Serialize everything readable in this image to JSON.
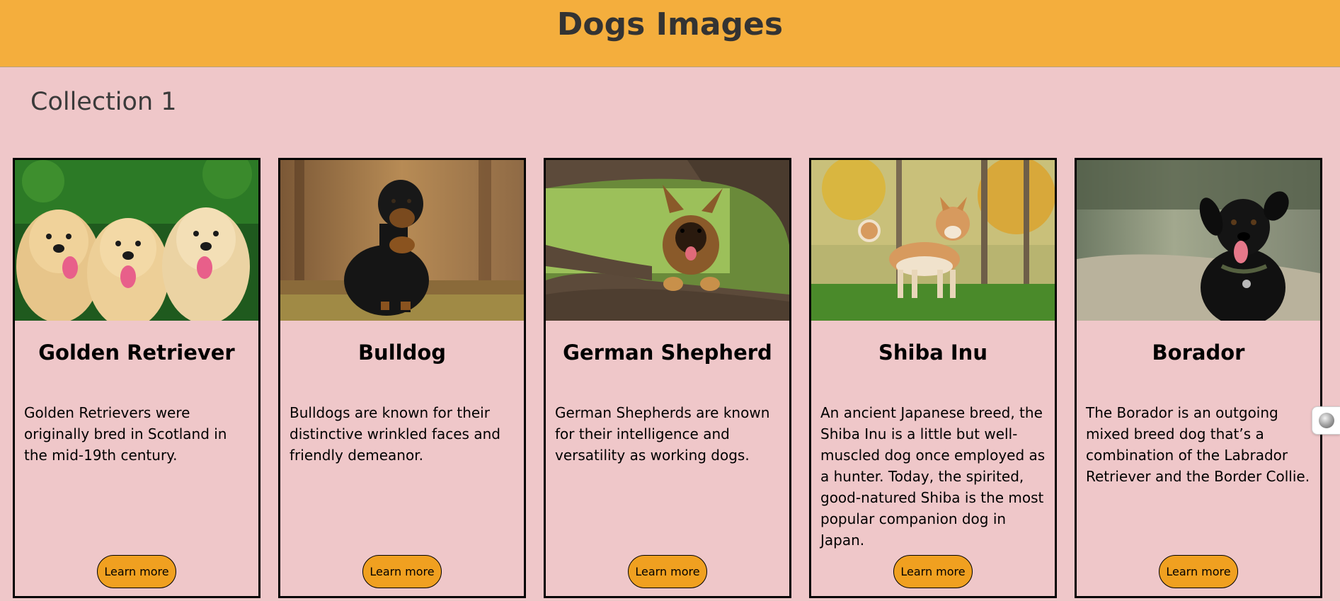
{
  "header": {
    "title": "Dogs Images"
  },
  "collection": {
    "title": "Collection 1"
  },
  "cards": [
    {
      "title": "Golden Retriever",
      "description": "Golden Retrievers were originally bred in Scotland in the mid-19th century.",
      "button_label": "Learn more",
      "image_icon": "golden-retriever-puppies-photo"
    },
    {
      "title": "Bulldog",
      "description": "Bulldogs are known for their distinctive wrinkled faces and friendly demeanor.",
      "button_label": "Learn more",
      "image_icon": "rottweiler-sitting-photo"
    },
    {
      "title": "German Shepherd",
      "description": "German Shepherds are known for their intelligence and versatility as working dogs.",
      "button_label": "Learn more",
      "image_icon": "german-shepherd-in-tree-photo"
    },
    {
      "title": "Shiba Inu",
      "description": "An ancient Japanese breed, the Shiba Inu is a little but well-muscled dog once employed as a hunter. Today, the spirited, good-natured Shiba is the most popular companion dog in Japan.",
      "button_label": "Learn more",
      "image_icon": "shiba-inu-standing-photo"
    },
    {
      "title": "Borador",
      "description": "The Borador is an outgoing mixed breed dog that’s a combination of the Labrador Retriever and the Border Collie.",
      "button_label": "Learn more",
      "image_icon": "black-borador-photo"
    }
  ],
  "colors": {
    "header_bg": "#f4ae3d",
    "page_bg": "#efc7c9",
    "button_bg": "#f0a020",
    "title_text": "#333333"
  }
}
